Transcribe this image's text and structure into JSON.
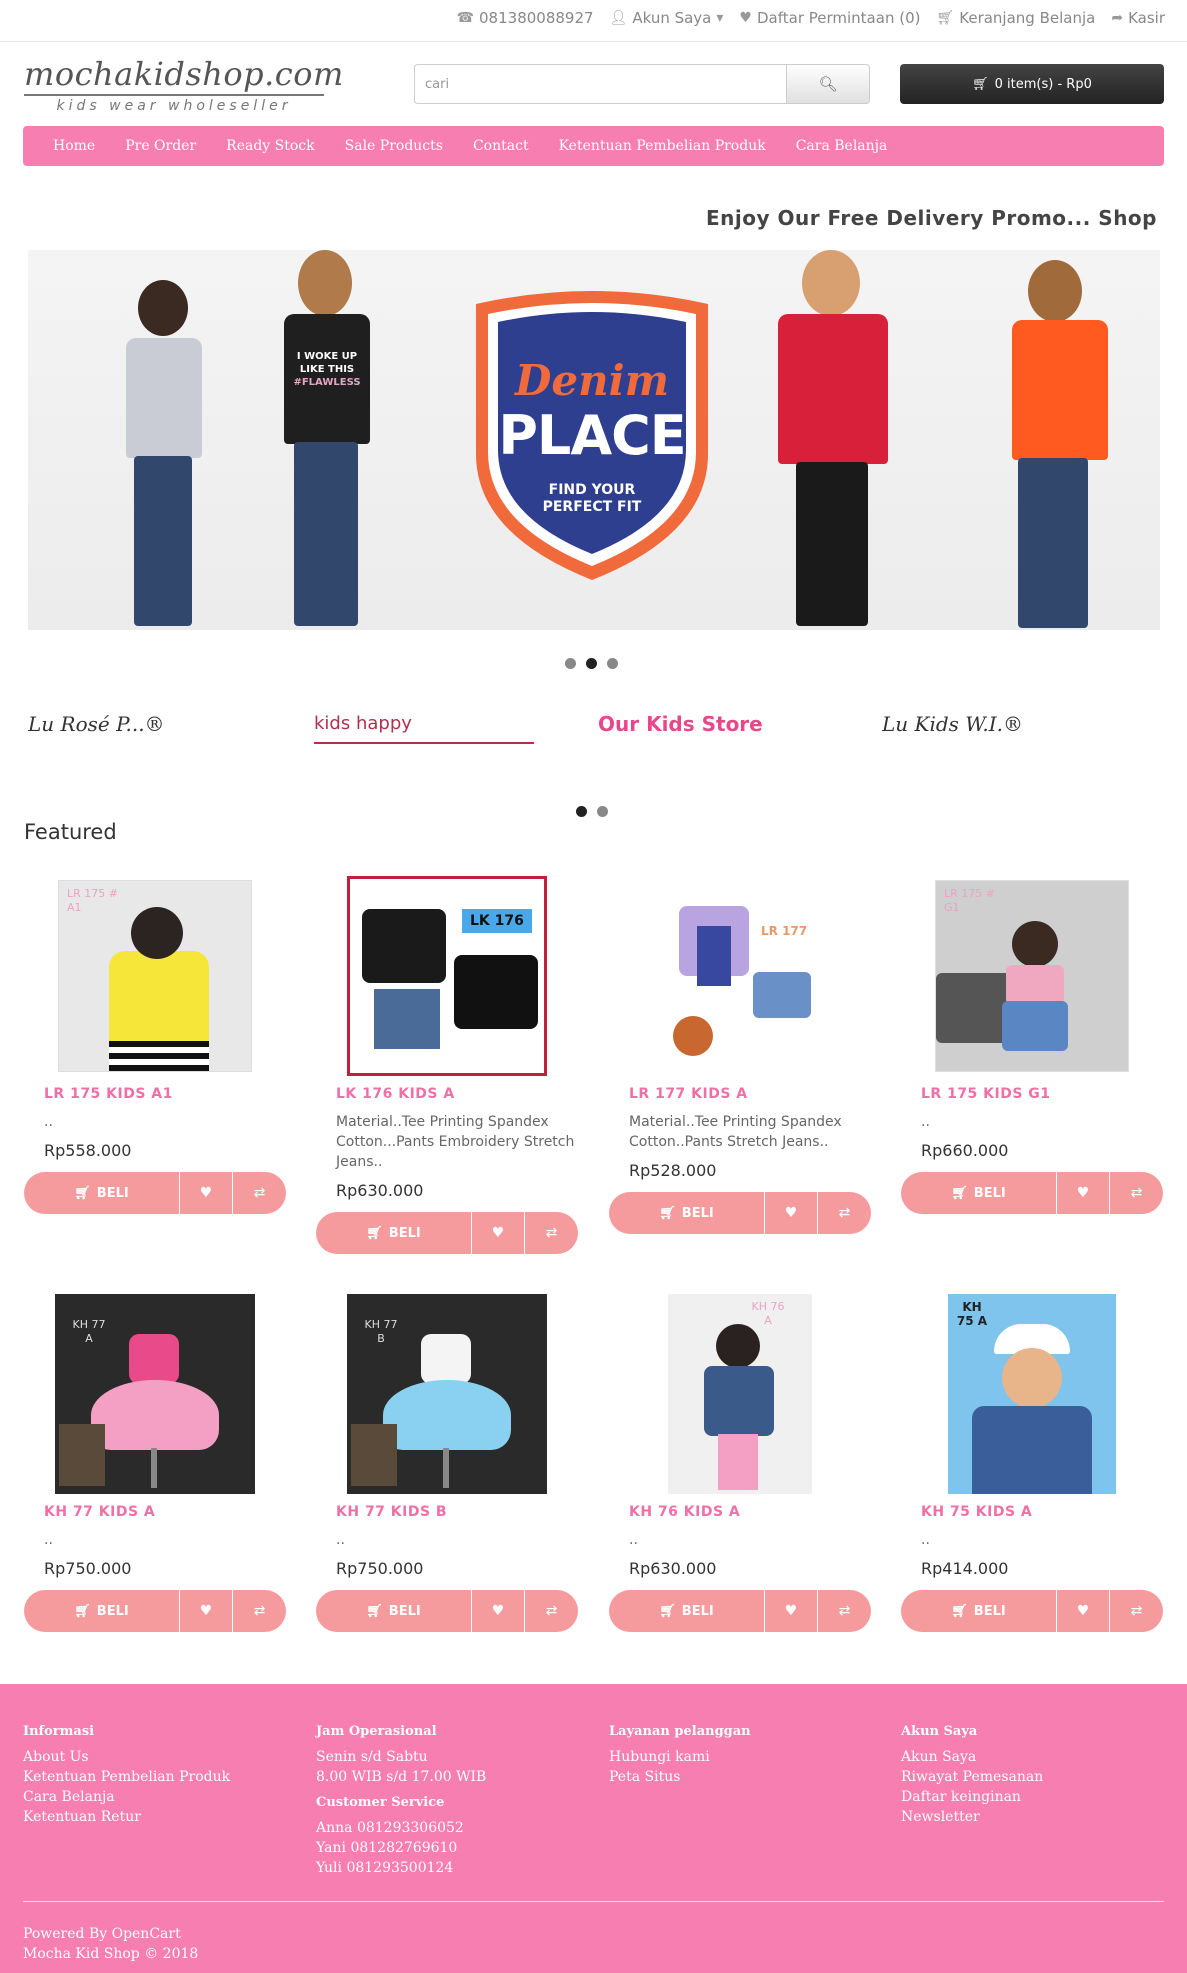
{
  "topbar": {
    "phone": "081380088927",
    "account": "Akun Saya",
    "wishlist": "Daftar Permintaan (0)",
    "cart": "Keranjang Belanja",
    "checkout": "Kasir"
  },
  "header": {
    "logo_main": "mochakidshop.com",
    "logo_sub": "kids wear wholeseller",
    "search_placeholder": "cari",
    "cart_button": "0 item(s) - Rp0"
  },
  "nav": [
    "Home",
    "Pre Order",
    "Ready Stock",
    "Sale Products",
    "Contact",
    "Ketentuan Pembelian Produk",
    "Cara Belanja"
  ],
  "promo_text": "Enjoy Our Free Delivery Promo... Shop",
  "banner": {
    "line1": "Denim",
    "line2": "PLACE",
    "line3": "FIND YOUR",
    "line4": "PERFECT FIT",
    "shirt_text1": "I WOKE UP",
    "shirt_text2": "LIKE THIS",
    "shirt_text3": "#FLAWLESS"
  },
  "brands": [
    "Lu Rosé P...®",
    "kids happy",
    "Our Kids Store",
    "Lu Kids W.I.®"
  ],
  "featured_title": "Featured",
  "products": [
    {
      "name": "LR 175 KIDS A1",
      "desc": "..",
      "price": "Rp558.000",
      "photo_label": "LR 175 # A1"
    },
    {
      "name": "LK 176 KIDS A",
      "desc": "Material..Tee Printing Spandex Cotton...Pants Embroidery Stretch Jeans..",
      "price": "Rp630.000",
      "photo_label": "LK 176"
    },
    {
      "name": "LR 177 KIDS A",
      "desc": "Material..Tee Printing Spandex Cotton..Pants Stretch Jeans..",
      "price": "Rp528.000",
      "photo_label": "LR 177"
    },
    {
      "name": "LR 175 KIDS G1",
      "desc": "..",
      "price": "Rp660.000",
      "photo_label": "LR 175 # G1"
    },
    {
      "name": "KH 77 KIDS A",
      "desc": "..",
      "price": "Rp750.000",
      "photo_label": "KH 77 A"
    },
    {
      "name": "KH 77 KIDS B",
      "desc": "..",
      "price": "Rp750.000",
      "photo_label": "KH 77 B"
    },
    {
      "name": "KH 76 KIDS A",
      "desc": "..",
      "price": "Rp630.000",
      "photo_label": "KH 76 A"
    },
    {
      "name": "KH 75 KIDS A",
      "desc": "..",
      "price": "Rp414.000",
      "photo_label": "KH 75 A"
    }
  ],
  "buy_label": "BELI",
  "footer": {
    "info_title": "Informasi",
    "info_links": [
      "About Us",
      "Ketentuan Pembelian Produk",
      "Cara Belanja",
      "Ketentuan Retur"
    ],
    "hours_title": "Jam Operasional",
    "hours_lines": [
      "Senin s/d Sabtu",
      "8.00 WIB s/d 17.00 WIB"
    ],
    "cs_title": "Customer Service",
    "cs_lines": [
      "Anna 081293306052",
      "Yani 081282769610",
      "Yuli 081293500124"
    ],
    "service_title": "Layanan pelanggan",
    "service_links": [
      "Hubungi kami",
      "Peta Situs"
    ],
    "account_title": "Akun Saya",
    "account_links": [
      "Akun Saya",
      "Riwayat Pemesanan",
      "Daftar keinginan",
      "Newsletter"
    ],
    "powered": "Powered By OpenCart",
    "copyright": "Mocha Kid Shop © 2018"
  },
  "colors": {
    "brand_pink": "#f77eb0",
    "button_salmon": "#f59b9e",
    "product_name": "#f06fa6"
  }
}
